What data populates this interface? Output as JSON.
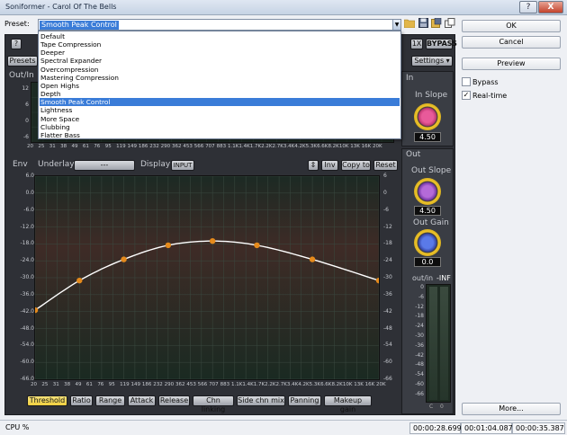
{
  "window": {
    "title": "Soniformer - Carol Of The Bells",
    "help_btn": "?",
    "close_btn": "X"
  },
  "preset": {
    "label": "Preset:",
    "current": "Smooth Peak Control",
    "options": [
      "Default",
      "Tape Compression",
      "Deeper",
      "Spectral Expander",
      "Overcompression",
      "Mastering Compression",
      "Open Highs",
      "Depth",
      "Smooth Peak Control",
      "Lightness",
      "More Space",
      "Clubbing",
      "Flatter Bass"
    ],
    "selected_index": 8
  },
  "right_panel": {
    "ok": "OK",
    "cancel": "Cancel",
    "preview": "Preview",
    "bypass": "Bypass",
    "bypass_checked": false,
    "realtime": "Real-time",
    "realtime_checked": true,
    "more": "More..."
  },
  "plugin": {
    "help": "?",
    "presets": "Presets",
    "one_x": "1X",
    "bypass": "BYPASS",
    "settings": "Settings ▾",
    "out_in": "Out/In",
    "in_section": "In",
    "in_slope": "In Slope",
    "in_slope_value": "4.50",
    "out_section": "Out",
    "out_slope": "Out Slope",
    "out_slope_value": "4.50",
    "out_gain": "Out Gain",
    "out_gain_value": "0.0",
    "meter_label": "out/in",
    "meter_value": "-INF",
    "meter_ticks": [
      "0",
      "-6",
      "-12",
      "-18",
      "-24",
      "-30",
      "-36",
      "-42",
      "-48",
      "-54",
      "-60",
      "-66"
    ],
    "meter_channels": [
      "C",
      "0"
    ],
    "env": "Env",
    "underlay": "Underlay",
    "underlay_value": "---",
    "display": "Display",
    "display_value": "INPUT",
    "stepper": "⇕",
    "inv": "Inv",
    "copy_to": "Copy to",
    "reset": "Reset",
    "freq_labels": [
      "20",
      "25",
      "31",
      "38",
      "49",
      "61",
      "76",
      "95",
      "119",
      "149",
      "186",
      "232",
      "290",
      "362",
      "453",
      "566",
      "707",
      "883",
      "1.1K",
      "1.4K",
      "1.7K",
      "2.2K",
      "2.7K",
      "3.4K",
      "4.2K",
      "5.3K",
      "6.6K",
      "8.2K",
      "10K",
      "13K",
      "16K",
      "20K"
    ],
    "small_db_labels": [
      "12",
      "6",
      "0",
      "-6"
    ],
    "db_labels": [
      "6.0",
      "0.0",
      "-6.0",
      "-12.0",
      "-18.0",
      "-24.0",
      "-30.0",
      "-36.0",
      "-42.0",
      "-48.0",
      "-54.0",
      "-60.0",
      "-66.0"
    ],
    "right_db_labels": [
      "6",
      "0",
      "-6",
      "-12",
      "-18",
      "-24",
      "-30",
      "-36",
      "-42",
      "-48",
      "-54",
      "-60",
      "-66"
    ],
    "tabs": [
      "Threshold",
      "Ratio",
      "Range",
      "Attack",
      "Release",
      "Chn linking",
      "Side chn mix",
      "Panning",
      "Makeup gain"
    ],
    "active_tab": 0
  },
  "curve_points": [
    {
      "freq_index": 0,
      "db": -41.5
    },
    {
      "freq_index": 4,
      "db": -31
    },
    {
      "freq_index": 8,
      "db": -23.5
    },
    {
      "freq_index": 12,
      "db": -18.5
    },
    {
      "freq_index": 16,
      "db": -17
    },
    {
      "freq_index": 20,
      "db": -18.5
    },
    {
      "freq_index": 25,
      "db": -23.5
    },
    {
      "freq_index": 31,
      "db": -31
    }
  ],
  "status": {
    "cpu": "CPU %",
    "time1": "00:00:28.699",
    "time2": "00:01:04.087",
    "time3": "00:00:35.387"
  },
  "colors": {
    "accent": "#3a7cd8",
    "tab_active": "#f0d040",
    "curve": "#ffffff",
    "point": "#e58a1c"
  }
}
